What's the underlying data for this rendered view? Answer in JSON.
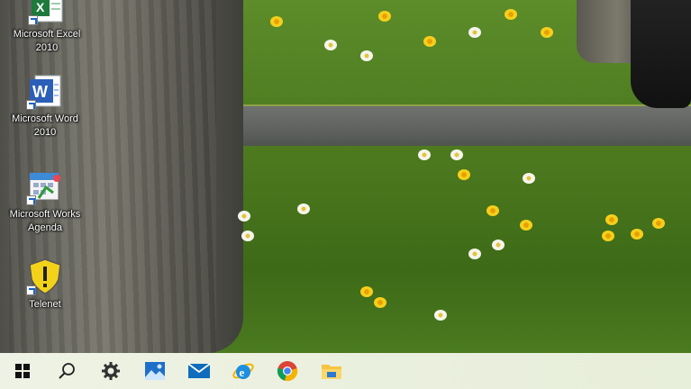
{
  "desktop": {
    "icons": [
      {
        "label": "Microsoft Excel 2010",
        "icon": "excel-icon"
      },
      {
        "label": "Microsoft Word 2010",
        "icon": "word-icon"
      },
      {
        "label": "Microsoft Works Agenda",
        "icon": "works-agenda-icon"
      },
      {
        "label": "Telenet",
        "icon": "telenet-shield-icon"
      }
    ]
  },
  "taskbar": {
    "items": [
      {
        "icon": "windows-start-icon"
      },
      {
        "icon": "search-icon"
      },
      {
        "icon": "settings-gear-icon"
      },
      {
        "icon": "photos-icon"
      },
      {
        "icon": "mail-icon"
      },
      {
        "icon": "internet-explorer-icon"
      },
      {
        "icon": "chrome-icon"
      },
      {
        "icon": "file-explorer-icon"
      }
    ]
  },
  "colors": {
    "taskbar_bg": "#eef2e4",
    "accent_blue": "#1c64c8",
    "chrome_red": "#db4437",
    "chrome_yellow": "#f4b400",
    "chrome_green": "#0f9d58"
  }
}
